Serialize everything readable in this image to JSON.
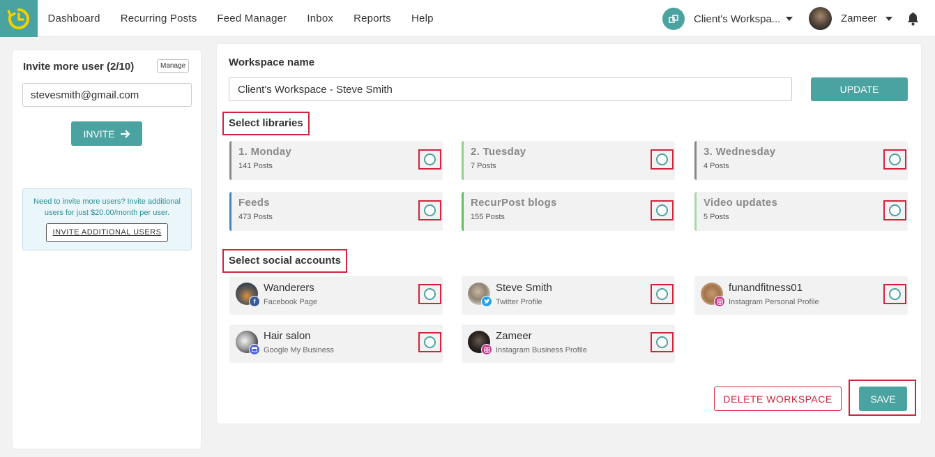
{
  "nav": {
    "items": [
      "Dashboard",
      "Recurring Posts",
      "Feed Manager",
      "Inbox",
      "Reports",
      "Help"
    ],
    "workspace": "Client's Workspa...",
    "user": "Zameer"
  },
  "invite": {
    "title": "Invite more user (2/10)",
    "manage": "Manage",
    "email": "stevesmith@gmail.com",
    "invite_button": "INVITE",
    "notice": "Need to invite more users? Invite additional users for just $20.00/month per user.",
    "notice_button": "INVITE ADDITIONAL USERS"
  },
  "workspace": {
    "label": "Workspace name",
    "name": "Client's Workspace - Steve Smith",
    "update_button": "UPDATE"
  },
  "libraries": {
    "label": "Select libraries",
    "items": [
      {
        "title": "1. Monday",
        "posts": "141 Posts",
        "color": "#888888"
      },
      {
        "title": "2. Tuesday",
        "posts": "7 Posts",
        "color": "#8fd08a"
      },
      {
        "title": "3. Wednesday",
        "posts": "4 Posts",
        "color": "#888888"
      },
      {
        "title": "Feeds",
        "posts": "473 Posts",
        "color": "#3a87c8"
      },
      {
        "title": "RecurPost blogs",
        "posts": "155 Posts",
        "color": "#5cbf5c"
      },
      {
        "title": "Video updates",
        "posts": "5 Posts",
        "color": "#a8d8a3"
      }
    ]
  },
  "social": {
    "label": "Select social accounts",
    "items": [
      {
        "name": "Wanderers",
        "type": "Facebook Page",
        "icon": "facebook-icon",
        "badge_color": "#3b5998"
      },
      {
        "name": "Steve Smith",
        "type": "Twitter Profile",
        "icon": "twitter-icon",
        "badge_color": "#1da1f2"
      },
      {
        "name": "funandfitness01",
        "type": "Instagram Personal Profile",
        "icon": "instagram-icon",
        "badge_color": "#c1358a"
      },
      {
        "name": "Hair salon",
        "type": "Google My Business",
        "icon": "google-my-business-icon",
        "badge_color": "#4b5ed8"
      },
      {
        "name": "Zameer",
        "type": "Instagram Business Profile",
        "icon": "instagram-icon",
        "badge_color": "#c1358a"
      }
    ]
  },
  "actions": {
    "delete": "DELETE WORKSPACE",
    "save": "SAVE"
  },
  "colors": {
    "accent": "#4aa3a0",
    "highlight": "#d0243c"
  }
}
